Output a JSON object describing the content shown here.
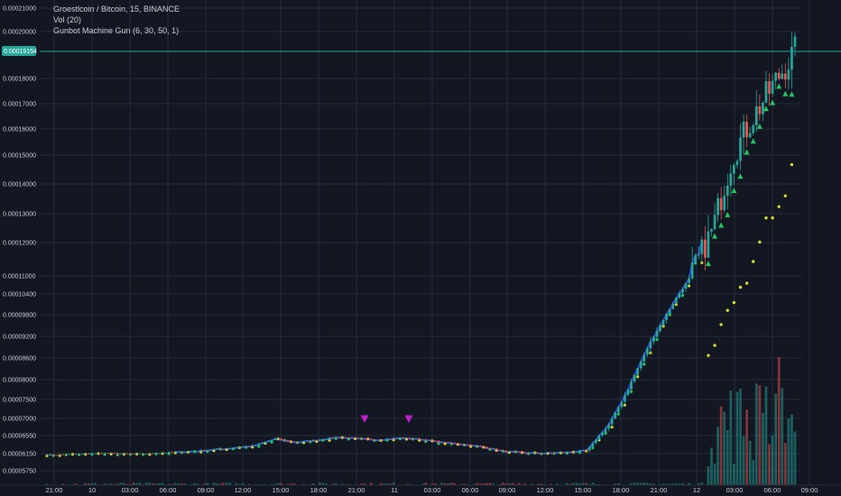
{
  "legend": {
    "title": "Groestlcoin / Bitcoin, 15, BINANCE",
    "volume": "Vol (20)",
    "indicator": "Gunbot Machine Gun (6, 30, 50, 1)"
  },
  "colors": {
    "background": "#131722",
    "grid": "#262b38",
    "up": "#26a69a",
    "down": "#ef5350",
    "buy_marker": "#22c45e",
    "sell_marker": "#c21fcc",
    "psar": "#d9d92a",
    "ema_flat": "#2f3fd4",
    "price_line": "#26a69a"
  },
  "chart_data": {
    "type": "candlestick",
    "symbol": "Groestlcoin / Bitcoin",
    "interval": "15",
    "exchange": "BINANCE",
    "current_price": "0.00019154",
    "y_tick_labels": [
      "0.00021000",
      "0.00020000",
      "0.00018000",
      "0.00017000",
      "0.00016000",
      "0.00015000",
      "0.00014000",
      "0.00013000",
      "0.00012000",
      "0.00011000",
      "0.00010400",
      "0.00009800",
      "0.00009200",
      "0.00008600",
      "0.00008000",
      "0.00007500",
      "0.00007000",
      "0.00006550",
      "0.00006150",
      "0.00005750"
    ],
    "x_tick_labels": [
      "21:00",
      "10",
      "03:00",
      "06:00",
      "09:00",
      "12:00",
      "15:00",
      "18:00",
      "21:00",
      "11",
      "03:00",
      "06:00",
      "09:00",
      "12:00",
      "15:00",
      "18:00",
      "21:00",
      "12",
      "03:00",
      "06:00",
      "09:00"
    ],
    "close_approx": [
      6.12e-05,
      6.13e-05,
      6.15e-05,
      6.16e-05,
      6.14e-05,
      6.15e-05,
      6.18e-05,
      6.2e-05,
      6.24e-05,
      6.28e-05,
      6.33e-05,
      6.48e-05,
      6.4e-05,
      6.45e-05,
      6.52e-05,
      6.48e-05,
      6.46e-05,
      6.5e-05,
      6.47e-05,
      6.4e-05,
      6.36e-05,
      6.3e-05,
      6.2e-05,
      6.17e-05,
      6.16e-05,
      6.18e-05,
      6.22e-05,
      6.8e-05,
      7.8e-05,
      9e-05,
      0.0001,
      0.00011,
      0.000124,
      0.00015,
      0.000165,
      0.000178,
      0.00019154
    ],
    "sell_signals": [
      "21:00 (day 10)",
      "00:00 (day 11)"
    ],
    "volume_label": "Vol (20)"
  }
}
